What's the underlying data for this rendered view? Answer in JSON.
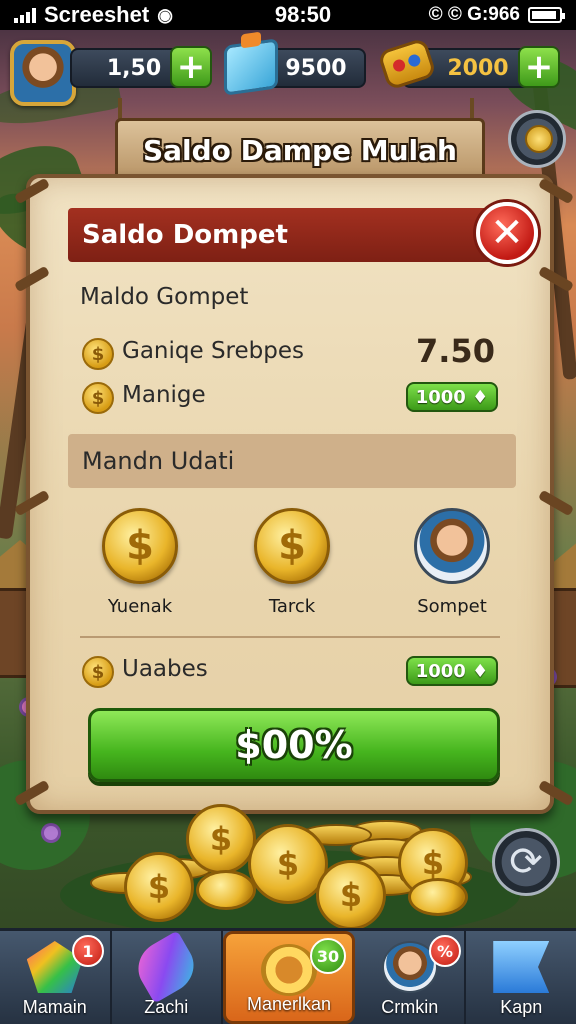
{
  "status_bar": {
    "carrier": "Screeshet",
    "time": "98:50",
    "right_text": "© © G:966"
  },
  "hud": {
    "coins_value": "1,50",
    "gems_value": "9500",
    "tickets_value": "2000",
    "plus_label": "+"
  },
  "sign": {
    "title": "Saldo Dampe Mulah"
  },
  "panel": {
    "header_title": "Saldo Dompet",
    "close_label": "✕",
    "subtitle": "Maldo Gompet",
    "row1": {
      "label": "Ganiqe Srebpes",
      "value": "7.50"
    },
    "row2": {
      "label": "Manige",
      "chip": "1000 ♦"
    },
    "section_title": "Mandn Udati",
    "rewards": [
      {
        "label": "Yuenak",
        "icon": "dollar-coin-icon"
      },
      {
        "label": "Tarck",
        "icon": "dollar-coin-icon"
      },
      {
        "label": "Sompet",
        "icon": "avatar-icon"
      }
    ],
    "row3": {
      "label": "Uaabes",
      "chip": "1000 ♦"
    },
    "main_button": "$00%"
  },
  "coin_symbol": "$",
  "refresh_label": "⟳",
  "nav": [
    {
      "label": "Mamain",
      "icon": "gem-icon",
      "badge": "1"
    },
    {
      "label": "Zachi",
      "icon": "rocket-icon",
      "badge": ""
    },
    {
      "label": "Manerlkan",
      "icon": "ring-icon",
      "badge": "30",
      "active": true
    },
    {
      "label": "Crmkin",
      "icon": "profile-icon",
      "badge": "%"
    },
    {
      "label": "Kapn",
      "icon": "flag-icon",
      "badge": ""
    }
  ],
  "colors": {
    "accent_green": "#46b51e",
    "header_red": "#a33020",
    "gold": "#e9b52a",
    "active_tab": "#f6a23a"
  }
}
